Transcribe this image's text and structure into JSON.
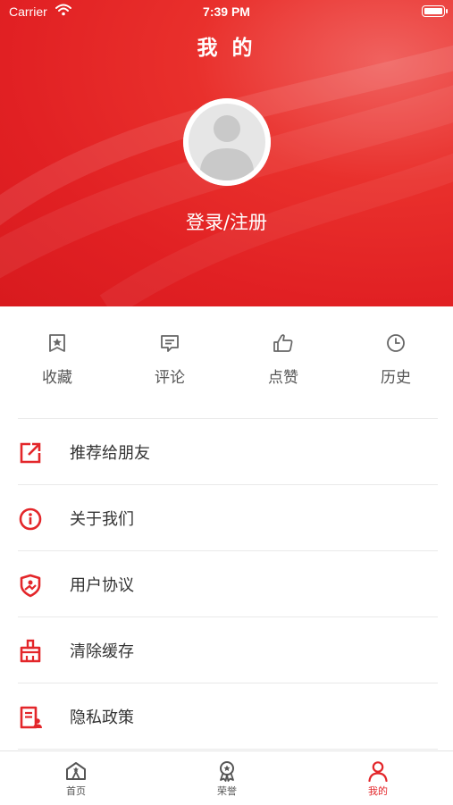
{
  "status_bar": {
    "carrier": "Carrier",
    "time": "7:39 PM"
  },
  "header": {
    "title": "我 的",
    "login_label": "登录/注册"
  },
  "quick_actions": [
    {
      "label": "收藏",
      "icon": "favorite-star-icon"
    },
    {
      "label": "评论",
      "icon": "comment-icon"
    },
    {
      "label": "点赞",
      "icon": "thumbs-up-icon"
    },
    {
      "label": "历史",
      "icon": "clock-icon"
    }
  ],
  "menu": [
    {
      "label": "推荐给朋友",
      "icon": "share-icon"
    },
    {
      "label": "关于我们",
      "icon": "info-icon"
    },
    {
      "label": "用户协议",
      "icon": "shield-icon"
    },
    {
      "label": "清除缓存",
      "icon": "broom-icon"
    },
    {
      "label": "隐私政策",
      "icon": "document-icon"
    }
  ],
  "tabbar": [
    {
      "label": "首页",
      "icon": "home-icon",
      "active": false
    },
    {
      "label": "荣誉",
      "icon": "medal-icon",
      "active": false
    },
    {
      "label": "我的",
      "icon": "user-icon",
      "active": true
    }
  ],
  "colors": {
    "accent": "#e3262a",
    "header_red": "#e12023",
    "icon_gray": "#666666",
    "divider": "#e9e9e9"
  }
}
